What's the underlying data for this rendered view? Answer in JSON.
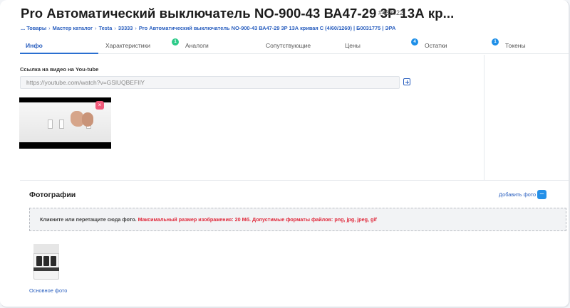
{
  "header": {
    "title": "Pro Автоматический выключатель NO-900-43 ВА47-29 3P 13А кр...",
    "sku": "#482022"
  },
  "breadcrumb": {
    "items": [
      "... Товары",
      "Мастер каталог",
      "Testa",
      "33333",
      "Pro Автоматический выключатель NO-900-43 ВА47-29 3P 13А кривая C (4/60/1260) | Б0031775 | ЭРА"
    ]
  },
  "tabs": [
    {
      "label": "Инфо",
      "badge": ""
    },
    {
      "label": "Характеристики",
      "badge": ""
    },
    {
      "label": "Аналоги",
      "badge": "1"
    },
    {
      "label": "Сопутствующие",
      "badge": ""
    },
    {
      "label": "Цены",
      "badge": ""
    },
    {
      "label": "Остатки",
      "badge": "4"
    },
    {
      "label": "Токены",
      "badge": "1"
    }
  ],
  "video": {
    "label": "Ссылка на видео на You-tube",
    "value": "https://youtube.com/watch?v=GSlUQBEFIlY",
    "delete_symbol": "×"
  },
  "photos": {
    "title": "Фотографии",
    "add_label": "Добавить фото",
    "add_symbol": "–",
    "dropzone_hint": "Кликните или перетащите сюда фото.",
    "dropzone_warning": "Максимальный размер изображения: 20 Мб. Допустимые форматы файлов: png, jpg, jpeg, gif",
    "main_photo_label": "Основное фото"
  },
  "colors": {
    "accent": "#2a5fbf",
    "badge_green": "#2ecb8a",
    "badge_blue": "#1e8fe8",
    "warning": "#e0283a",
    "delete": "#f05a7a"
  }
}
